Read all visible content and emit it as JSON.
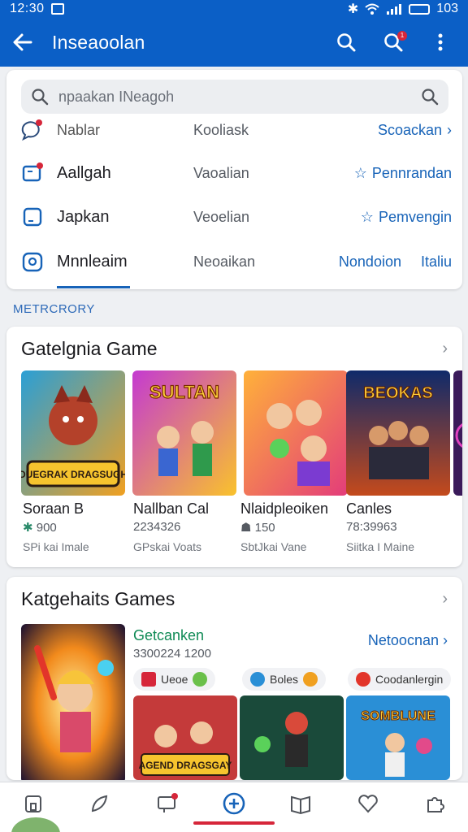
{
  "status": {
    "time": "12:30",
    "battery": "103"
  },
  "appbar": {
    "title": "Inseaoolan",
    "notification_count": "1"
  },
  "search": {
    "placeholder": "npaakan  INeagoh"
  },
  "menu": [
    {
      "name": "Nablar",
      "sub": "Kooliask",
      "action": "Scoackan",
      "icon": "chat-icon"
    },
    {
      "name": "Aallgah",
      "sub": "Vaoalian",
      "action": "Pennrandan",
      "icon": "folder-icon"
    },
    {
      "name": "Japkan",
      "sub": "Veoelian",
      "action": "Pemvengin",
      "icon": "page-icon"
    },
    {
      "name": "Mnnleaim",
      "sub": "Neoaikan",
      "action": "Nondoion",
      "action2": "Italiu",
      "icon": "camera-icon"
    }
  ],
  "section_label": "METRCRORY",
  "category": {
    "title": "Gatelgnia Game",
    "games": [
      {
        "name": "Soraan B",
        "meta": "900",
        "sub": "SPi kai Imale",
        "logo": "DUEGRAK DRAGSUGH"
      },
      {
        "name": "Nallban Cal",
        "meta": "2234326",
        "sub": "GPskai Voats",
        "logo": "SULTAN"
      },
      {
        "name": "Nlaidpleoiken",
        "meta": "150",
        "sub": "SbtJkai Vane",
        "logo": ""
      },
      {
        "name": "Canles",
        "meta": "78:39963",
        "sub": "Siitka I Maine",
        "logo": "BEOKAS"
      }
    ]
  },
  "featured": {
    "title": "Katgehaits Games",
    "item_title": "Getcanken",
    "item_meta": "3300224 1200",
    "action": "Netoocnan",
    "chips": [
      "Ueoe",
      "Boles",
      "Coodanlergin"
    ],
    "thumbs": [
      "AGEND DRAGSGAY",
      "",
      "SOMBLUNE"
    ]
  },
  "colors": {
    "primary": "#0b5fc6",
    "accent": "#1763b8",
    "alert": "#d6263a",
    "green": "#0f8a55"
  }
}
